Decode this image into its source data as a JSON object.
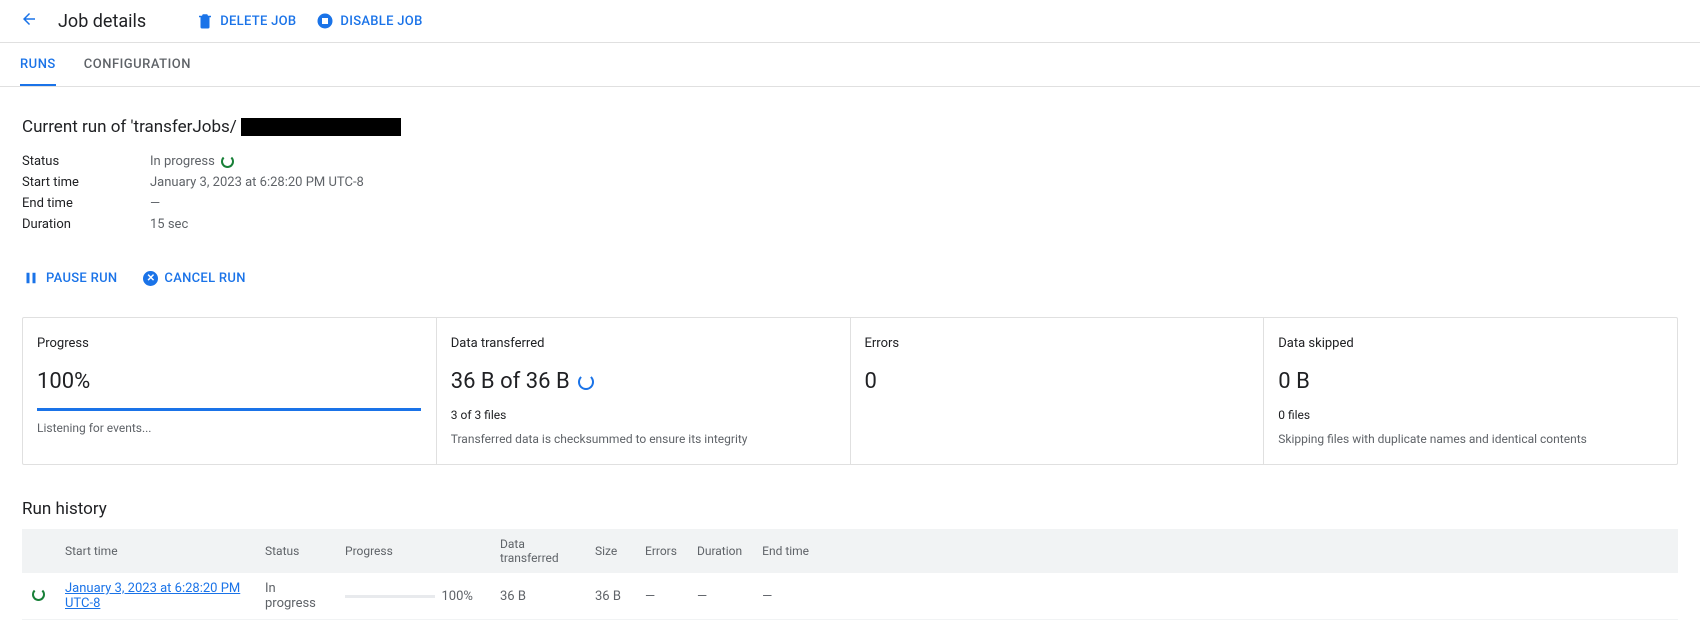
{
  "header": {
    "title": "Job details",
    "delete_label": "DELETE JOB",
    "disable_label": "DISABLE JOB"
  },
  "tabs": {
    "runs": "RUNS",
    "configuration": "CONFIGURATION"
  },
  "current_run": {
    "title_prefix": "Current run of 'transferJobs/",
    "rows": {
      "status_key": "Status",
      "status_val": "In progress",
      "start_time_key": "Start time",
      "start_time_val": "January 3, 2023 at 6:28:20 PM UTC-8",
      "end_time_key": "End time",
      "end_time_val": "—",
      "duration_key": "Duration",
      "duration_val": "15 sec"
    }
  },
  "actions": {
    "pause": "PAUSE RUN",
    "cancel": "CANCEL RUN"
  },
  "metrics": {
    "progress": {
      "label": "Progress",
      "value": "100%",
      "sub": "Listening for events..."
    },
    "transferred": {
      "label": "Data transferred",
      "value": "36 B of 36 B",
      "files": "3 of 3 files",
      "note": "Transferred data is checksummed to ensure its integrity"
    },
    "errors": {
      "label": "Errors",
      "value": "0"
    },
    "skipped": {
      "label": "Data skipped",
      "value": "0 B",
      "files": "0 files",
      "note": "Skipping files with duplicate names and identical contents"
    }
  },
  "history": {
    "title": "Run history",
    "columns": {
      "start_time": "Start time",
      "status": "Status",
      "progress": "Progress",
      "data_transferred": "Data transferred",
      "size": "Size",
      "errors": "Errors",
      "duration": "Duration",
      "end_time": "End time"
    },
    "row": {
      "start_time": "January 3, 2023 at 6:28:20 PM UTC-8",
      "status": "In progress",
      "progress_pct": "100%",
      "data_transferred": "36 B",
      "size": "36 B",
      "errors": "—",
      "duration": "—",
      "end_time": "—"
    }
  }
}
